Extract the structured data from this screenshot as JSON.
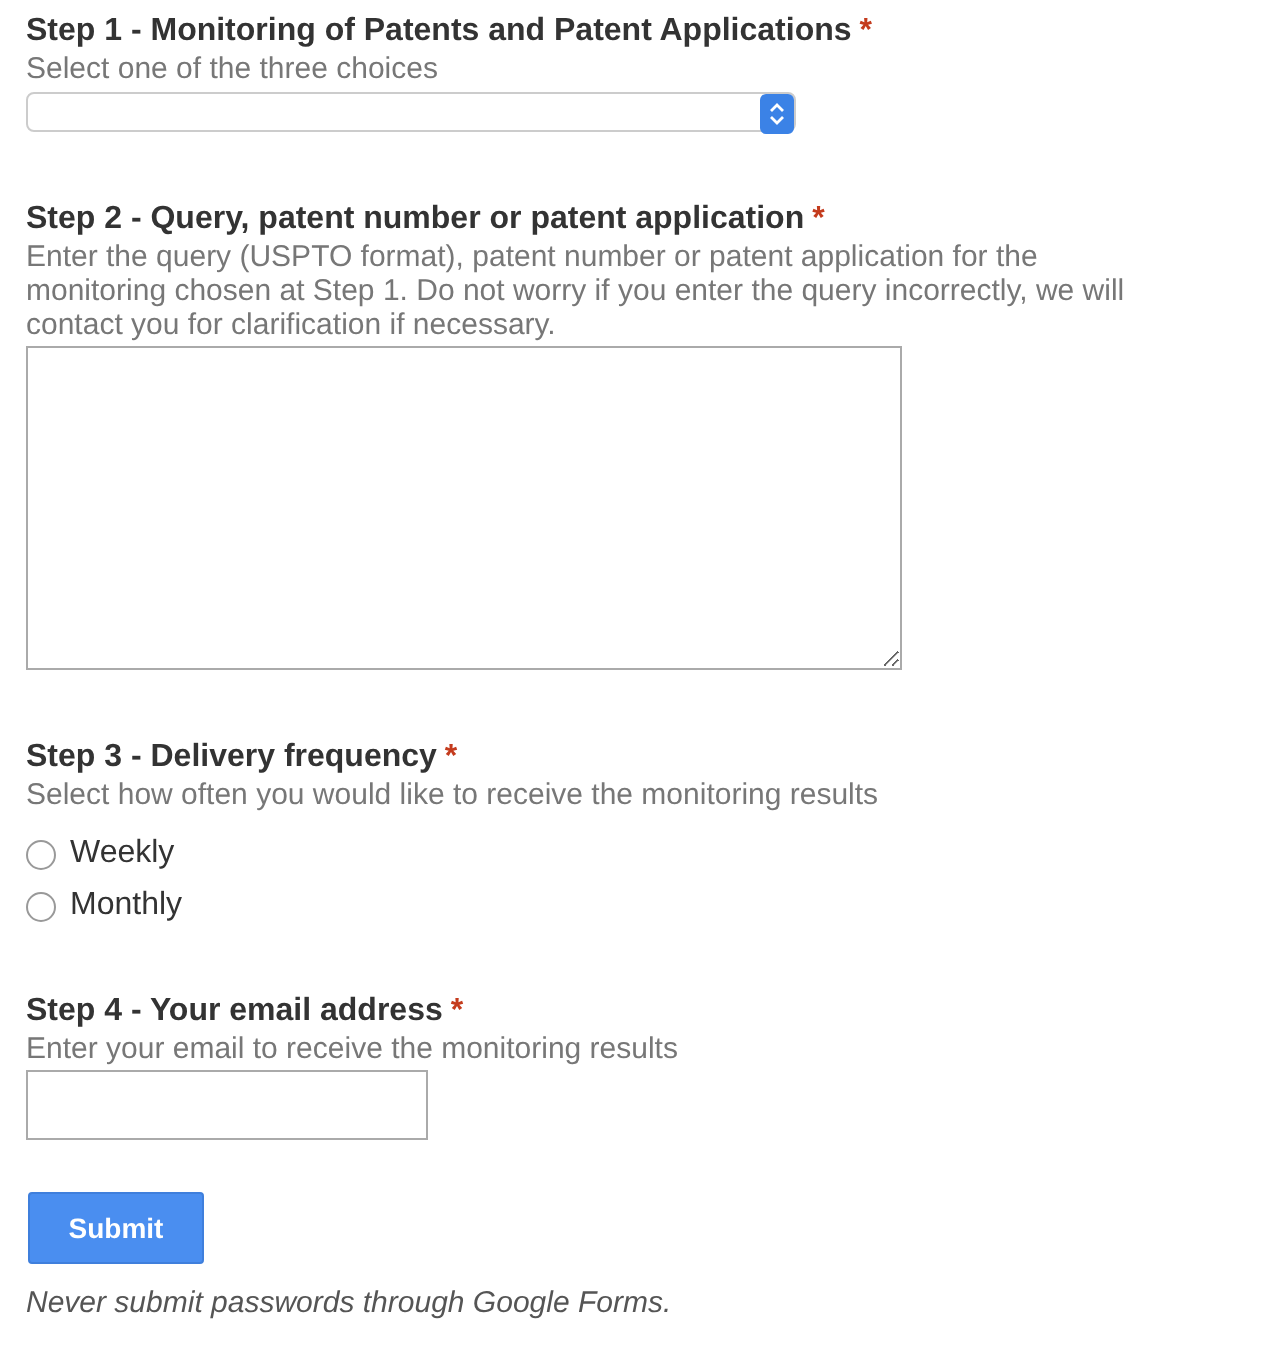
{
  "questions": [
    {
      "kind": "select",
      "title": "Step 1 - Monitoring of Patents and Patent Applications",
      "required_mark": "*",
      "help": "Select one of the three choices"
    },
    {
      "kind": "textarea",
      "title": "Step 2 - Query, patent number or patent application",
      "required_mark": "*",
      "help": "Enter the query (USPTO format), patent number or patent application for the monitoring chosen at Step 1. Do not worry if you enter the query incorrectly, we will contact you for clarification if necessary."
    },
    {
      "kind": "radio",
      "title": "Step 3 - Delivery frequency",
      "required_mark": "*",
      "help": "Select how often you would like to receive the monitoring results",
      "options": [
        {
          "label": "Weekly",
          "selected": false
        },
        {
          "label": "Monthly",
          "selected": false
        }
      ]
    },
    {
      "kind": "text",
      "title": "Step 4 - Your email address",
      "required_mark": "*",
      "help": "Enter your email to receive the monitoring results"
    }
  ],
  "submit": "Submit",
  "footer": "Never submit passwords through Google Forms."
}
